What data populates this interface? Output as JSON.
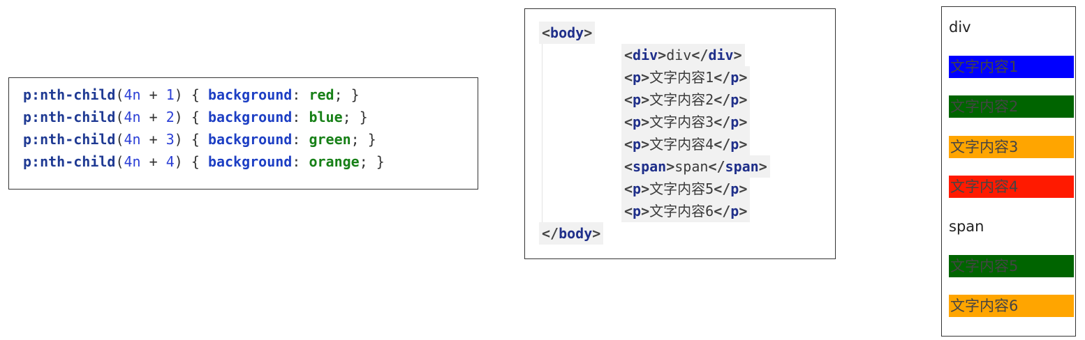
{
  "css_rules": [
    {
      "selector": "p:nth-child",
      "open_paren": "(",
      "expr_a": "4n",
      "op": " + ",
      "expr_b": "1",
      "close_paren": ")",
      "open_brace": " { ",
      "property": "background",
      "colon": ": ",
      "value": "red",
      "end": "; }"
    },
    {
      "selector": "p:nth-child",
      "open_paren": "(",
      "expr_a": "4n",
      "op": " + ",
      "expr_b": "2",
      "close_paren": ")",
      "open_brace": " { ",
      "property": "background",
      "colon": ": ",
      "value": "blue",
      "end": "; }"
    },
    {
      "selector": "p:nth-child",
      "open_paren": "(",
      "expr_a": "4n",
      "op": " + ",
      "expr_b": "3",
      "close_paren": ")",
      "open_brace": " { ",
      "property": "background",
      "colon": ": ",
      "value": "green",
      "end": "; }"
    },
    {
      "selector": "p:nth-child",
      "open_paren": "(",
      "expr_a": "4n",
      "op": " + ",
      "expr_b": "4",
      "close_paren": ")",
      "open_brace": " { ",
      "property": "background",
      "colon": ": ",
      "value": "orange",
      "end": "; }"
    }
  ],
  "html_source": {
    "body_open": {
      "lt": "<",
      "tag": "body",
      "gt": ">"
    },
    "children": [
      {
        "tag": "div",
        "text": "div"
      },
      {
        "tag": "p",
        "text": "文字内容1"
      },
      {
        "tag": "p",
        "text": "文字内容2"
      },
      {
        "tag": "p",
        "text": "文字内容3"
      },
      {
        "tag": "p",
        "text": "文字内容4"
      },
      {
        "tag": "span",
        "text": "span"
      },
      {
        "tag": "p",
        "text": "文字内容5"
      },
      {
        "tag": "p",
        "text": "文字内容6"
      }
    ],
    "body_close": {
      "lt": "</",
      "tag": "body",
      "gt": ">"
    }
  },
  "rendered_result": [
    {
      "text": "div",
      "bg": ""
    },
    {
      "text": "文字内容1",
      "bg": "#0000ff"
    },
    {
      "text": "文字内容2",
      "bg": "#006400"
    },
    {
      "text": "文字内容3",
      "bg": "#ffa500"
    },
    {
      "text": "文字内容4",
      "bg": "#ff1a00"
    },
    {
      "text": "span",
      "bg": ""
    },
    {
      "text": "文字内容5",
      "bg": "#006400"
    },
    {
      "text": "文字内容6",
      "bg": "#ffa500"
    }
  ]
}
